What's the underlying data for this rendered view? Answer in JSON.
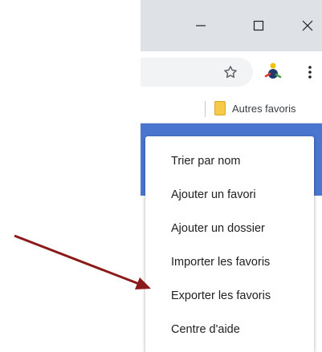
{
  "window_controls": {
    "minimize_icon": "minimize-icon",
    "maximize_icon": "maximize-icon",
    "close_icon": "close-icon"
  },
  "toolbar": {
    "star_icon": "star-icon",
    "extension_icon": "extension-icon",
    "menu_icon": "more-vert-icon"
  },
  "bookmarks_bar": {
    "folder_label": "Autres favoris",
    "folder_color": "#f7c948"
  },
  "menu": {
    "items": [
      "Trier par nom",
      "Ajouter un favori",
      "Ajouter un dossier",
      "Importer les favoris",
      "Exporter les favoris",
      "Centre d'aide"
    ]
  },
  "colors": {
    "header_blue": "#4a76cf",
    "arrow": "#8b1a1a"
  }
}
